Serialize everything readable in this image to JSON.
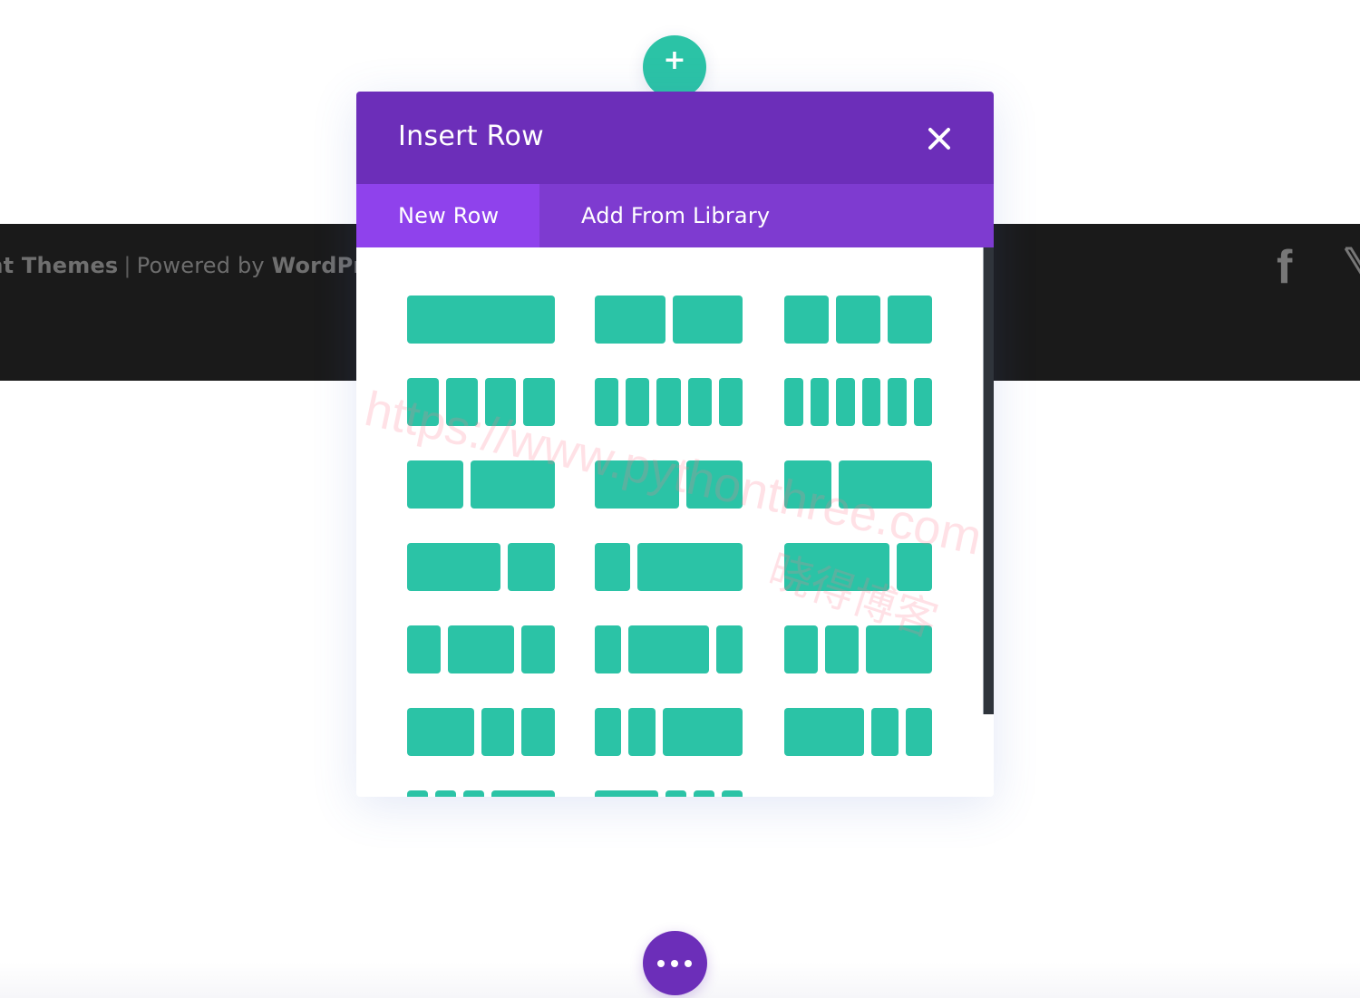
{
  "footer": {
    "credits_brand": "ant Themes",
    "credits_separator": "|",
    "credits_powered": "Powered by",
    "credits_platform": "WordPr",
    "social_icons": [
      "facebook-icon",
      "x-twitter-icon"
    ]
  },
  "add_row_button": {
    "icon": "plus-icon",
    "label": "+"
  },
  "modal": {
    "title": "Insert Row",
    "close_icon": "close-icon",
    "tabs": [
      {
        "label": "New Row",
        "active": true
      },
      {
        "label": "Add From Library",
        "active": false
      }
    ],
    "layouts": [
      [
        [
          1
        ],
        [
          1,
          1
        ],
        [
          1,
          1,
          1
        ]
      ],
      [
        [
          1,
          1,
          1,
          1
        ],
        [
          1,
          1,
          1,
          1,
          1
        ],
        [
          1,
          1,
          1,
          1,
          1,
          1
        ]
      ],
      [
        [
          2,
          3
        ],
        [
          3,
          2
        ],
        [
          1,
          2
        ]
      ],
      [
        [
          2,
          1
        ],
        [
          1,
          3
        ],
        [
          3,
          1
        ]
      ],
      [
        [
          1,
          2,
          1
        ],
        [
          1,
          3,
          1
        ],
        [
          1,
          1,
          2
        ]
      ],
      [
        [
          2,
          1,
          1
        ],
        [
          1,
          1,
          3
        ],
        [
          3,
          1,
          1
        ]
      ],
      [
        [
          1,
          1,
          1,
          3
        ],
        [
          3,
          1,
          1,
          1
        ]
      ]
    ],
    "scroll_fraction_visible": 0.85
  },
  "watermark": {
    "url": "https://www.pythonthree.com",
    "cn": "晓得博客"
  },
  "more_button": {
    "icon": "more-dots-icon"
  },
  "colors": {
    "accent_teal": "#2bc3a6",
    "header_purple": "#6c2eb9",
    "tabs_purple": "#7e3bd0",
    "active_tab_purple": "#8f42ec",
    "footer_bg": "#1a1a1a"
  }
}
